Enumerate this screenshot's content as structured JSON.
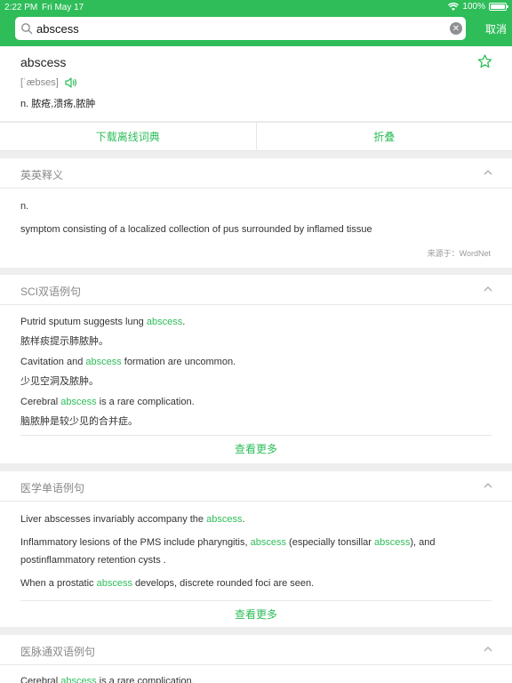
{
  "status": {
    "time": "2:22 PM",
    "date": "Fri May 17",
    "battery": "100%"
  },
  "search": {
    "query": "abscess",
    "placeholder": "",
    "cancel_label": "取消"
  },
  "word": {
    "headword": "abscess",
    "phonetic": "[ˈæbses]",
    "definition": "n. 脓疮,溃疡,脓肿"
  },
  "actions": {
    "download": "下载离线词典",
    "fold": "折叠"
  },
  "english_def": {
    "title": "英英释义",
    "pos": "n.",
    "text": "symptom consisting of a localized collection of pus surrounded by inflamed tissue",
    "source": "来源于：WordNet"
  },
  "sci": {
    "title": "SCI双语例句",
    "examples": [
      {
        "en": [
          "Putrid sputum suggests lung ",
          "abscess",
          "."
        ],
        "zh": "脓样痰提示肺脓肿。"
      },
      {
        "en": [
          "Cavitation and ",
          "abscess",
          " formation are uncommon."
        ],
        "zh": "少见空洞及脓肿。"
      },
      {
        "en": [
          "Cerebral ",
          "abscess",
          " is a rare complication."
        ],
        "zh": "脑脓肿是较少见的合并症。"
      }
    ],
    "more": "查看更多"
  },
  "medical": {
    "title": "医学单语例句",
    "line1": [
      "Liver abscesses invariably accompany the ",
      "abscess",
      "."
    ],
    "line2": [
      "Inflammatory lesions of the PMS include pharyngitis, ",
      "abscess",
      " (especially tonsillar ",
      "abscess",
      "), and"
    ],
    "line3": "postinflammatory retention cysts .",
    "line4": [
      "When a prostatic ",
      "abscess",
      " develops, discrete rounded foci are seen."
    ],
    "more": "查看更多"
  },
  "yimai": {
    "title": "医脉通双语例句",
    "partial": [
      "Cerebral ",
      "abscess",
      " is a rare complication."
    ]
  },
  "colors": {
    "accent": "#2ebd59",
    "header": "#2ebd59"
  }
}
